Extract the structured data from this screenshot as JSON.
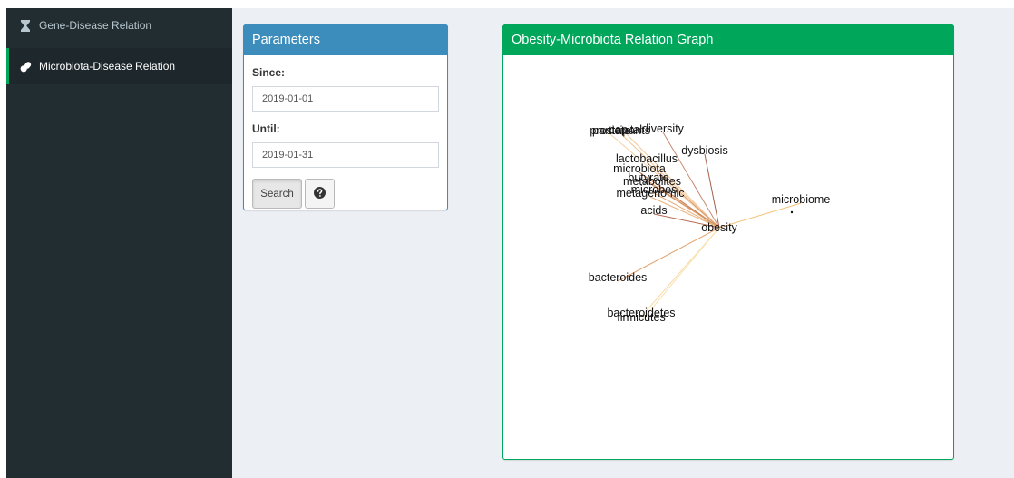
{
  "sidebar": {
    "items": [
      {
        "label": "Gene-Disease Relation",
        "icon": "hourglass-icon",
        "active": false
      },
      {
        "label": "Microbiota-Disease Relation",
        "icon": "pills-icon",
        "active": true
      }
    ]
  },
  "parameters": {
    "title": "Parameters",
    "since_label": "Since:",
    "since_value": "2019-01-01",
    "until_label": "Until:",
    "until_value": "2019-01-31",
    "search_label": "Search",
    "help_icon": "question-circle-icon"
  },
  "graph": {
    "title": "Obesity-Microbiota Relation Graph",
    "center": "obesity",
    "nodes": [
      {
        "label": "diversity",
        "color": "#c98a6e"
      },
      {
        "label": "capital",
        "color": "#f2c89a"
      },
      {
        "label": "prostate",
        "color": "#f4d0a6"
      },
      {
        "label": "participants",
        "color": "#f2c89a"
      },
      {
        "label": "dysbiosis",
        "color": "#a4614e"
      },
      {
        "label": "lactobacillus",
        "color": "#d99a6c"
      },
      {
        "label": "microbiota",
        "color": "#c77548"
      },
      {
        "label": "butyrate",
        "color": "#e0a070"
      },
      {
        "label": "metabolites",
        "color": "#d8955f"
      },
      {
        "label": "microbes",
        "color": "#e6ad7a"
      },
      {
        "label": "metagenomic",
        "color": "#e9b27c"
      },
      {
        "label": "acids",
        "color": "#b56a4f"
      },
      {
        "label": "microbiome",
        "color": "#f6c37a"
      },
      {
        "label": "bacteroides",
        "color": "#e4a06a"
      },
      {
        "label": "bacteroidetes",
        "color": "#f7dca8"
      },
      {
        "label": "firmicutes",
        "color": "#f9e2b4"
      }
    ]
  }
}
